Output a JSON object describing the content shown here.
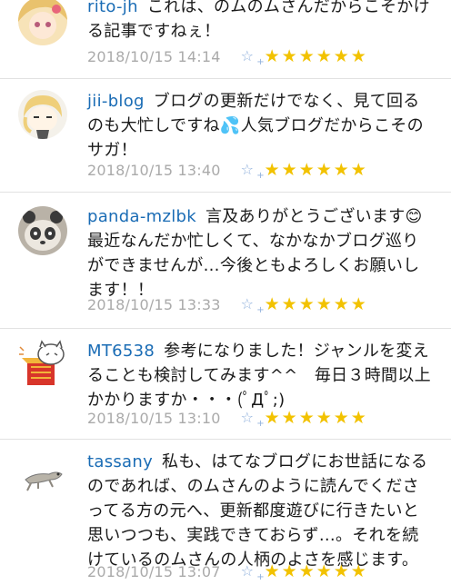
{
  "comments": [
    {
      "user": "rito-jh",
      "text": "これは、のムのムさんだからこそかける記事ですねぇ！",
      "timestamp": "2018/10/15 14:14",
      "add_star_icon": "add-star-icon",
      "stars": "★★★★★★"
    },
    {
      "user": "jii-blog",
      "text": "ブログの更新だけでなく、見て回るのも大忙しですね💦人気ブログだからこそのサガ！",
      "timestamp": "2018/10/15 13:40",
      "add_star_icon": "add-star-icon",
      "stars": "★★★★★★"
    },
    {
      "user": "panda-mzlbk",
      "text": "言及ありがとうございます😊最近なんだか忙しくて、なかなかブログ巡りができませんが…今後ともよろしくお願いします！！",
      "timestamp": "2018/10/15 13:33",
      "add_star_icon": "add-star-icon",
      "stars": "★★★★★★"
    },
    {
      "user": "MT6538",
      "text": "参考になりました！ジャンルを変えることも検討してみます^^　毎日３時間以上かかりますか・・・(ﾟДﾟ;)",
      "timestamp": "2018/10/15 13:10",
      "add_star_icon": "add-star-icon",
      "stars": "★★★★★★"
    },
    {
      "user": "tassany",
      "text": "私も、はてなブログにお世話になるのであれば、のムさんのように読んでくださってる方の元へ、更新都度遊びに行きたいと思いつつも、実践できておらず…。それを続けているのムさんの人柄のよさを感じます。",
      "timestamp": "2018/10/15 13:07",
      "add_star_icon": "add-star-icon",
      "stars": "★★★★★★"
    }
  ],
  "colors": {
    "username": "#1a6cb5",
    "timestamp": "#aaaaaa",
    "star": "#f2c200",
    "add_star": "#8fb0dc"
  }
}
